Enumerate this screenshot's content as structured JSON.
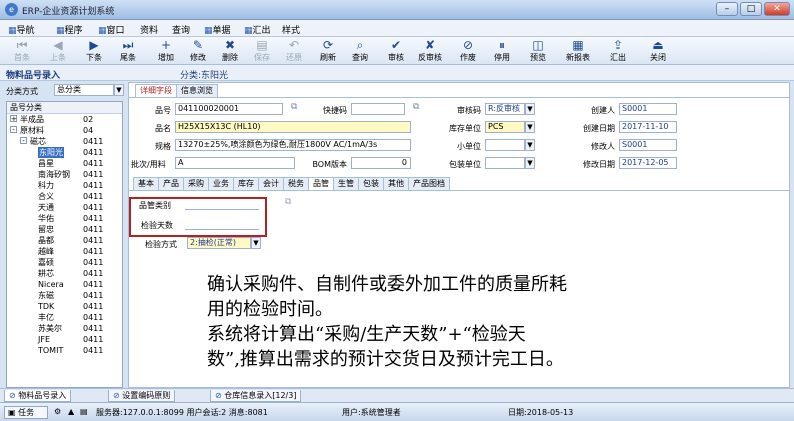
{
  "window": {
    "title": "ERP-企业资源计划系统"
  },
  "menu": [
    "导航",
    "程序",
    "窗口",
    "资料",
    "查询",
    "单据",
    "汇出",
    "样式"
  ],
  "toolbar": [
    {
      "label": "首条",
      "icon": "first-icon",
      "enabled": false
    },
    {
      "label": "上条",
      "icon": "prev-icon",
      "enabled": false
    },
    {
      "label": "下条",
      "icon": "next-icon",
      "enabled": true
    },
    {
      "label": "尾条",
      "icon": "last-icon",
      "enabled": true
    },
    {
      "label": "增加",
      "icon": "add-icon",
      "enabled": true
    },
    {
      "label": "修改",
      "icon": "edit-icon",
      "enabled": true
    },
    {
      "label": "删除",
      "icon": "delete-icon",
      "enabled": true
    },
    {
      "label": "保存",
      "icon": "save-icon",
      "enabled": false
    },
    {
      "label": "还原",
      "icon": "undo-icon",
      "enabled": false
    },
    {
      "label": "刷新",
      "icon": "refresh-icon",
      "enabled": true
    },
    {
      "label": "查询",
      "icon": "query-icon",
      "enabled": true
    },
    {
      "label": "审核",
      "icon": "audit-icon",
      "enabled": true
    },
    {
      "label": "反审核",
      "icon": "unaudit-icon",
      "enabled": true
    },
    {
      "label": "作废",
      "icon": "void-icon",
      "enabled": true
    },
    {
      "label": "停用",
      "icon": "disable-icon",
      "enabled": true
    },
    {
      "label": "预览",
      "icon": "preview-icon",
      "enabled": true
    },
    {
      "label": "新报表",
      "icon": "report-icon",
      "enabled": true
    },
    {
      "label": "汇出",
      "icon": "export-icon",
      "enabled": true
    },
    {
      "label": "关闭",
      "icon": "close-icon",
      "enabled": true
    }
  ],
  "header": {
    "left": "物料品号录入",
    "right": "分类:东阳光"
  },
  "classify": {
    "label": "分类方式",
    "value": "总分类"
  },
  "tree": {
    "col1": "品号分类",
    "rows": [
      {
        "name": "半成品",
        "code": "02",
        "indent": 0,
        "exp": "+"
      },
      {
        "name": "原材料",
        "code": "04",
        "indent": 0,
        "exp": "-"
      },
      {
        "name": "磁芯",
        "code": "0411",
        "indent": 1,
        "exp": "-"
      },
      {
        "name": "东阳光",
        "code": "0411",
        "indent": 2,
        "exp": "",
        "selected": true
      },
      {
        "name": "昌星",
        "code": "0411",
        "indent": 2,
        "exp": ""
      },
      {
        "name": "南海矽钢",
        "code": "0411",
        "indent": 2,
        "exp": ""
      },
      {
        "name": "科力",
        "code": "0411",
        "indent": 2,
        "exp": ""
      },
      {
        "name": "合义",
        "code": "0411",
        "indent": 2,
        "exp": ""
      },
      {
        "name": "天通",
        "code": "0411",
        "indent": 2,
        "exp": ""
      },
      {
        "name": "华佑",
        "code": "0411",
        "indent": 2,
        "exp": ""
      },
      {
        "name": "留忠",
        "code": "0411",
        "indent": 2,
        "exp": ""
      },
      {
        "name": "晶都",
        "code": "0411",
        "indent": 2,
        "exp": ""
      },
      {
        "name": "越峰",
        "code": "0411",
        "indent": 2,
        "exp": ""
      },
      {
        "name": "嘉硕",
        "code": "0411",
        "indent": 2,
        "exp": ""
      },
      {
        "name": "耕芯",
        "code": "0411",
        "indent": 2,
        "exp": ""
      },
      {
        "name": "Nicera",
        "code": "0411",
        "indent": 2,
        "exp": ""
      },
      {
        "name": "东磁",
        "code": "0411",
        "indent": 2,
        "exp": ""
      },
      {
        "name": "TDK",
        "code": "0411",
        "indent": 2,
        "exp": ""
      },
      {
        "name": "丰亿",
        "code": "0411",
        "indent": 2,
        "exp": ""
      },
      {
        "name": "苏美尔",
        "code": "0411",
        "indent": 2,
        "exp": ""
      },
      {
        "name": "JFE",
        "code": "0411",
        "indent": 2,
        "exp": ""
      },
      {
        "name": "TOMIT",
        "code": "0411",
        "indent": 2,
        "exp": ""
      }
    ]
  },
  "topTabs": [
    "详细字段",
    "信息浏览"
  ],
  "form": {
    "pinhao_label": "品号",
    "pinhao": "041100020001",
    "kuaijie_label": "快捷码",
    "kuaijie": "",
    "shenhe_label": "审核码",
    "shenhe": "R:反审核",
    "chuangjian_label": "创建人",
    "chuangjian": "S0001",
    "pinming_label": "品名",
    "pinming": "H25X15X13C (HL10)",
    "kucun_label": "库存单位",
    "kucun": "PCS",
    "cjrq_label": "创建日期",
    "cjrq": "2017-11-10",
    "guige_label": "规格",
    "guige": "13270±25%,喷涂颜色为绿色,耐压1800V AC/1mA/3s",
    "xiaodan_label": "小单位",
    "xiaodan": "",
    "xiugai_label": "修改人",
    "xiugai": "S0001",
    "pici_label": "批次/用料",
    "pici": "A",
    "bom_label": "BOM版本",
    "bom": "0",
    "baozhuang_label": "包装单位",
    "baozhuang": "",
    "xgrq_label": "修改日期",
    "xgrq": "2017-12-05"
  },
  "subTabs": [
    "基本",
    "产品",
    "采购",
    "业务",
    "库存",
    "会计",
    "税务",
    "品管",
    "生管",
    "包装",
    "其他",
    "产品图档"
  ],
  "qc": {
    "pgleibie_label": "品管类别",
    "pgleibie": "",
    "jyts_label": "检验天数",
    "jyts": "",
    "jyfs_label": "检验方式",
    "jyfs": "2:抽检(正常)"
  },
  "note": [
    "确认采购件、自制件或委外加工件的质量所耗",
    "用的检验时间。",
    "系统将计算出“采购/生产天数”+“检验天",
    "数”,推算出需求的预计交货日及预计完工日。"
  ],
  "docTabs": [
    "物料品号录入",
    "设置编码原则",
    "仓库信息录入[12/3]"
  ],
  "status": {
    "task": "任务",
    "server": "服务器:127.0.0.1:8099 用户会话:2 消息:8081",
    "user": "用户:系统管理者",
    "date": "日期:2018-05-13"
  },
  "colors": {
    "accent": "#1f4a93",
    "highlight": "#b22222",
    "selected": "#3a6fc4"
  }
}
